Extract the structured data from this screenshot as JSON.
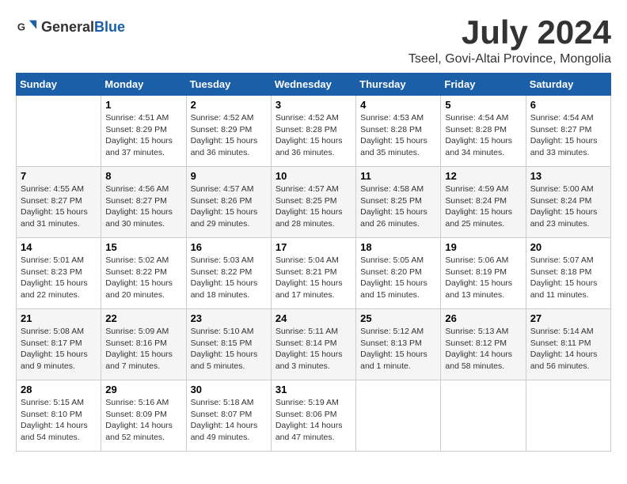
{
  "logo": {
    "general": "General",
    "blue": "Blue"
  },
  "title": {
    "month": "July 2024",
    "location": "Tseel, Govi-Altai Province, Mongolia"
  },
  "headers": [
    "Sunday",
    "Monday",
    "Tuesday",
    "Wednesday",
    "Thursday",
    "Friday",
    "Saturday"
  ],
  "weeks": [
    [
      {
        "day": "",
        "content": ""
      },
      {
        "day": "1",
        "content": "Sunrise: 4:51 AM\nSunset: 8:29 PM\nDaylight: 15 hours and 37 minutes."
      },
      {
        "day": "2",
        "content": "Sunrise: 4:52 AM\nSunset: 8:29 PM\nDaylight: 15 hours and 36 minutes."
      },
      {
        "day": "3",
        "content": "Sunrise: 4:52 AM\nSunset: 8:28 PM\nDaylight: 15 hours and 36 minutes."
      },
      {
        "day": "4",
        "content": "Sunrise: 4:53 AM\nSunset: 8:28 PM\nDaylight: 15 hours and 35 minutes."
      },
      {
        "day": "5",
        "content": "Sunrise: 4:54 AM\nSunset: 8:28 PM\nDaylight: 15 hours and 34 minutes."
      },
      {
        "day": "6",
        "content": "Sunrise: 4:54 AM\nSunset: 8:27 PM\nDaylight: 15 hours and 33 minutes."
      }
    ],
    [
      {
        "day": "7",
        "content": "Sunrise: 4:55 AM\nSunset: 8:27 PM\nDaylight: 15 hours and 31 minutes."
      },
      {
        "day": "8",
        "content": "Sunrise: 4:56 AM\nSunset: 8:27 PM\nDaylight: 15 hours and 30 minutes."
      },
      {
        "day": "9",
        "content": "Sunrise: 4:57 AM\nSunset: 8:26 PM\nDaylight: 15 hours and 29 minutes."
      },
      {
        "day": "10",
        "content": "Sunrise: 4:57 AM\nSunset: 8:25 PM\nDaylight: 15 hours and 28 minutes."
      },
      {
        "day": "11",
        "content": "Sunrise: 4:58 AM\nSunset: 8:25 PM\nDaylight: 15 hours and 26 minutes."
      },
      {
        "day": "12",
        "content": "Sunrise: 4:59 AM\nSunset: 8:24 PM\nDaylight: 15 hours and 25 minutes."
      },
      {
        "day": "13",
        "content": "Sunrise: 5:00 AM\nSunset: 8:24 PM\nDaylight: 15 hours and 23 minutes."
      }
    ],
    [
      {
        "day": "14",
        "content": "Sunrise: 5:01 AM\nSunset: 8:23 PM\nDaylight: 15 hours and 22 minutes."
      },
      {
        "day": "15",
        "content": "Sunrise: 5:02 AM\nSunset: 8:22 PM\nDaylight: 15 hours and 20 minutes."
      },
      {
        "day": "16",
        "content": "Sunrise: 5:03 AM\nSunset: 8:22 PM\nDaylight: 15 hours and 18 minutes."
      },
      {
        "day": "17",
        "content": "Sunrise: 5:04 AM\nSunset: 8:21 PM\nDaylight: 15 hours and 17 minutes."
      },
      {
        "day": "18",
        "content": "Sunrise: 5:05 AM\nSunset: 8:20 PM\nDaylight: 15 hours and 15 minutes."
      },
      {
        "day": "19",
        "content": "Sunrise: 5:06 AM\nSunset: 8:19 PM\nDaylight: 15 hours and 13 minutes."
      },
      {
        "day": "20",
        "content": "Sunrise: 5:07 AM\nSunset: 8:18 PM\nDaylight: 15 hours and 11 minutes."
      }
    ],
    [
      {
        "day": "21",
        "content": "Sunrise: 5:08 AM\nSunset: 8:17 PM\nDaylight: 15 hours and 9 minutes."
      },
      {
        "day": "22",
        "content": "Sunrise: 5:09 AM\nSunset: 8:16 PM\nDaylight: 15 hours and 7 minutes."
      },
      {
        "day": "23",
        "content": "Sunrise: 5:10 AM\nSunset: 8:15 PM\nDaylight: 15 hours and 5 minutes."
      },
      {
        "day": "24",
        "content": "Sunrise: 5:11 AM\nSunset: 8:14 PM\nDaylight: 15 hours and 3 minutes."
      },
      {
        "day": "25",
        "content": "Sunrise: 5:12 AM\nSunset: 8:13 PM\nDaylight: 15 hours and 1 minute."
      },
      {
        "day": "26",
        "content": "Sunrise: 5:13 AM\nSunset: 8:12 PM\nDaylight: 14 hours and 58 minutes."
      },
      {
        "day": "27",
        "content": "Sunrise: 5:14 AM\nSunset: 8:11 PM\nDaylight: 14 hours and 56 minutes."
      }
    ],
    [
      {
        "day": "28",
        "content": "Sunrise: 5:15 AM\nSunset: 8:10 PM\nDaylight: 14 hours and 54 minutes."
      },
      {
        "day": "29",
        "content": "Sunrise: 5:16 AM\nSunset: 8:09 PM\nDaylight: 14 hours and 52 minutes."
      },
      {
        "day": "30",
        "content": "Sunrise: 5:18 AM\nSunset: 8:07 PM\nDaylight: 14 hours and 49 minutes."
      },
      {
        "day": "31",
        "content": "Sunrise: 5:19 AM\nSunset: 8:06 PM\nDaylight: 14 hours and 47 minutes."
      },
      {
        "day": "",
        "content": ""
      },
      {
        "day": "",
        "content": ""
      },
      {
        "day": "",
        "content": ""
      }
    ]
  ]
}
